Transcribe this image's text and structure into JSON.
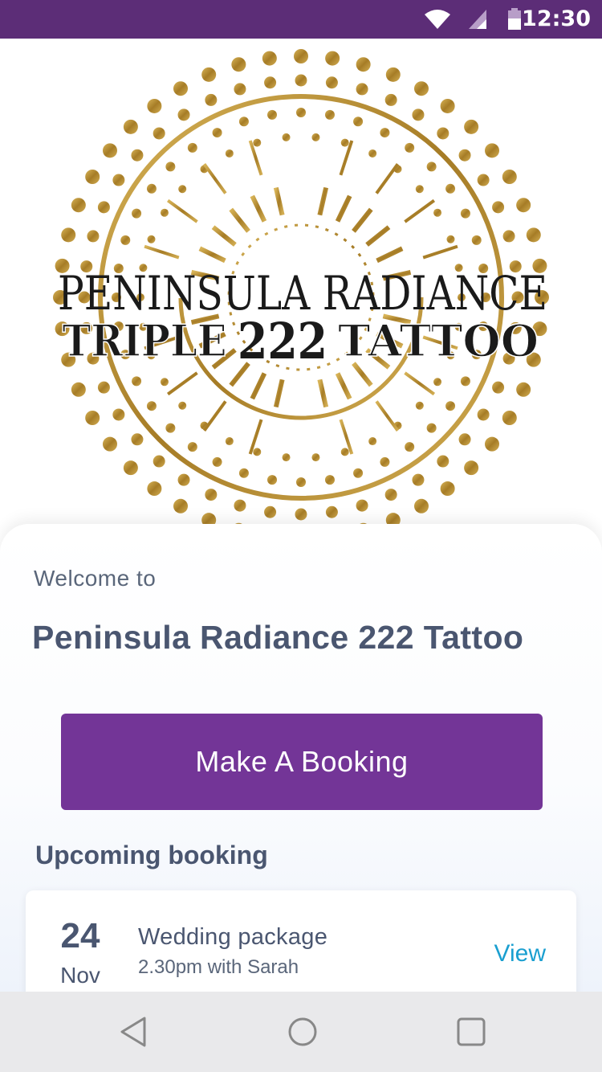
{
  "status_bar": {
    "time": "12:30",
    "icons": [
      "wifi-icon",
      "signal-icon",
      "battery-icon"
    ]
  },
  "logo": {
    "line1": "PENINSULA RADIANCE",
    "line2_left": "TRIPLE",
    "line2_right": "TATTOO",
    "emblem": "222"
  },
  "welcome": {
    "prefix": "Welcome to",
    "business_name": "Peninsula Radiance 222 Tattoo"
  },
  "cta": {
    "label": "Make A Booking"
  },
  "upcoming": {
    "heading": "Upcoming booking",
    "booking": {
      "day": "24",
      "month": "Nov",
      "title": "Wedding package",
      "detail": "2.30pm with Sarah",
      "action": "View"
    }
  },
  "navigation": {
    "buttons": [
      "back-icon",
      "home-icon",
      "recents-icon"
    ]
  },
  "colors": {
    "status_bar": "#5c2d77",
    "primary": "#733597",
    "link": "#1a9fd0",
    "text": "#4a5670",
    "gold": "#b8902e"
  }
}
